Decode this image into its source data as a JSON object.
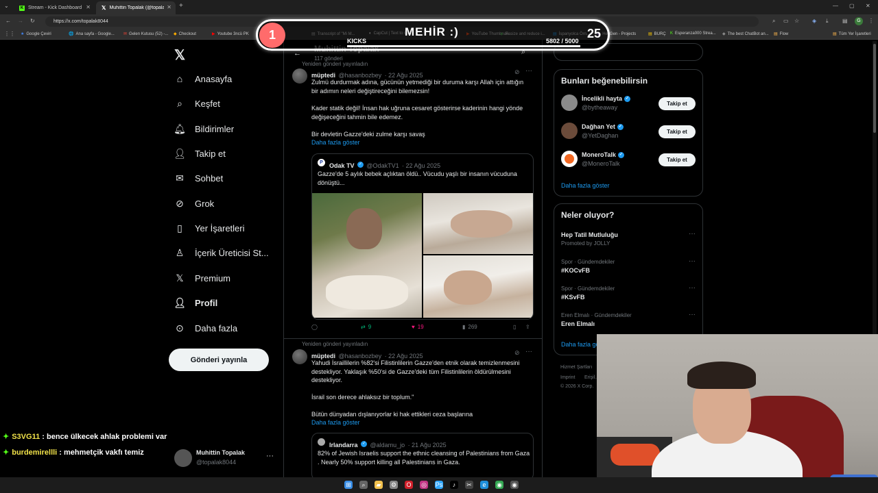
{
  "browser": {
    "tabs": [
      {
        "label": "Stream - Kick Dashboard",
        "active": false
      },
      {
        "label": "Muhittin Topalak (@topalak8044) / X",
        "active": true
      }
    ],
    "url": "https://x.com/topalak8044",
    "bookmarks": [
      "Google Çeviri",
      "Ana sayfa - Google...",
      "Gelen Kutusu (52) -...",
      "Checkout",
      "Youtube 3ncü PK",
      "Transcript of \"Mi M...",
      "CapCut | Text to sp...",
      "YouTube Thumbnail...",
      "Resize and reduce i...",
      "İspanyolca Örn...",
      "HeyGen - Projects",
      "BURÇ",
      "Esperanza000 Strea...",
      "The best ChatBot an...",
      "Flow",
      "Tüm Yer İşaretleri"
    ]
  },
  "overlay": {
    "goal_number": "1",
    "goal_title": "MEHİR :)",
    "goal_label": "KICKS",
    "goal_progress_text": "5802  / 5000",
    "goal_right": "25",
    "goal_fill_fraction": 1.0
  },
  "profile_header": {
    "name": "Muhittin Topalak",
    "posts_count": "117 gönderi"
  },
  "nav": {
    "items": [
      {
        "label": "Anasayfa",
        "icon": "home-icon"
      },
      {
        "label": "Keşfet",
        "icon": "search-icon"
      },
      {
        "label": "Bildirimler",
        "icon": "bell-icon"
      },
      {
        "label": "Takip et",
        "icon": "follow-icon"
      },
      {
        "label": "Sohbet",
        "icon": "mail-icon"
      },
      {
        "label": "Grok",
        "icon": "grok-icon"
      },
      {
        "label": "Yer İşaretleri",
        "icon": "bookmark-icon"
      },
      {
        "label": "İçerik Üreticisi St...",
        "icon": "creator-icon"
      },
      {
        "label": "Premium",
        "icon": "x-logo-icon"
      },
      {
        "label": "Profil",
        "icon": "user-icon"
      },
      {
        "label": "Daha fazla",
        "icon": "more-circle-icon"
      }
    ],
    "post_button": "Gönderi yayınla",
    "account_name": "Muhittin Topalak",
    "account_handle": "@topalak8044"
  },
  "tweets": [
    {
      "repost_label": "Yeniden gönderi yayınladın",
      "name": "müptedi",
      "handle": "@hasanbozbey",
      "date": "· 22 Ağu 2025",
      "text1": "Zulmü durdurmak adına, gücünün yetmediği bir duruma karşı Allah için attığın bir adımın neleri değiştireceğini bilemezsin!",
      "text2": "Kader statik değil! İnsan hak uğruna cesaret gösterirse kaderinin hangi yönde değişeceğini tahmin bile edemez.",
      "text3": "Bir devletin Gazze'deki zulme karşı savaş",
      "more": "Daha fazla göster",
      "quote": {
        "name": "Odak TV",
        "handle": "@OdakTV1",
        "date": "· 22 Ağu 2025",
        "text": "Gazze'de 5 aylık bebek açlıktan öldü.. Vücudu yaşlı bir insanın vücuduna dönüştü..."
      },
      "actions": {
        "reply": "",
        "repost": "9",
        "like": "19",
        "views": "269"
      }
    },
    {
      "repost_label": "Yeniden gönderi yayınladın",
      "name": "müptedi",
      "handle": "@hasanbozbey",
      "date": "· 22 Ağu 2025",
      "text1": "Yahudi İsraillilerin %82'si Filistinlilerin Gazze'den etnik olarak temizlenmesini destekliyor. Yaklaşık %50'si de Gazze'deki tüm Filistinlilerin öldürülmesini destekliyor.",
      "text2": "İsrail son derece ahlaksız bir toplum.\"",
      "text3": "Bütün dünyadan dışlanıyorlar ki hak ettikleri ceza başlarına",
      "more": "Daha fazla göster",
      "quote": {
        "name": "Irlandarra",
        "handle": "@aldamu_jo",
        "date": "· 21 Ağu 2025",
        "text": "82% of Jewish Israelis support the ethnic cleansing of Palestinians from Gaza . Nearly 50% support killing all Palestinians in Gaza."
      }
    }
  ],
  "who_to_follow": {
    "title": "Bunları beğenebilirsin",
    "follow_label": "Takip et",
    "users": [
      {
        "name": "İncelikli hayta",
        "handle": "@bytheaway"
      },
      {
        "name": "Dağhan Yet",
        "handle": "@YetDaghan"
      },
      {
        "name": "MoneroTalk",
        "handle": "@MoneroTalk"
      }
    ],
    "show_more": "Daha fazla göster"
  },
  "trends": {
    "title": "Neler oluyor?",
    "items": [
      {
        "context": "",
        "name": "Hep Tatil Mutluluğu",
        "sub": "Promoted by JOLLY"
      },
      {
        "context": "Spor · Gündemdekiler",
        "name": "#KOCvFB",
        "sub": ""
      },
      {
        "context": "Spor · Gündemdekiler",
        "name": "#KSvFB",
        "sub": ""
      },
      {
        "context": "Eren Elmalı · Gündemdekiler",
        "name": "Eren Elmalı",
        "sub": ""
      }
    ],
    "show_more": "Daha fazla göster"
  },
  "footer": {
    "links": [
      "Hizmet Şartları",
      "Imprint",
      "Erişil..."
    ],
    "copyright": "© 2026 X Corp."
  },
  "stream_chat": [
    {
      "user": "S3VG11",
      "message": " : bence ülkecek ahlak problemi var",
      "color": "#f2e34a"
    },
    {
      "user": "burdemirellli",
      "message": " : mehmetçik vakfı temiz",
      "color": "#f2e34a"
    }
  ],
  "colors": {
    "accent": "#1d9bf0",
    "background": "#000000",
    "kick_green": "#53fc18",
    "goal_bubble": "#ff6b6b",
    "like_pink": "#f91880"
  }
}
